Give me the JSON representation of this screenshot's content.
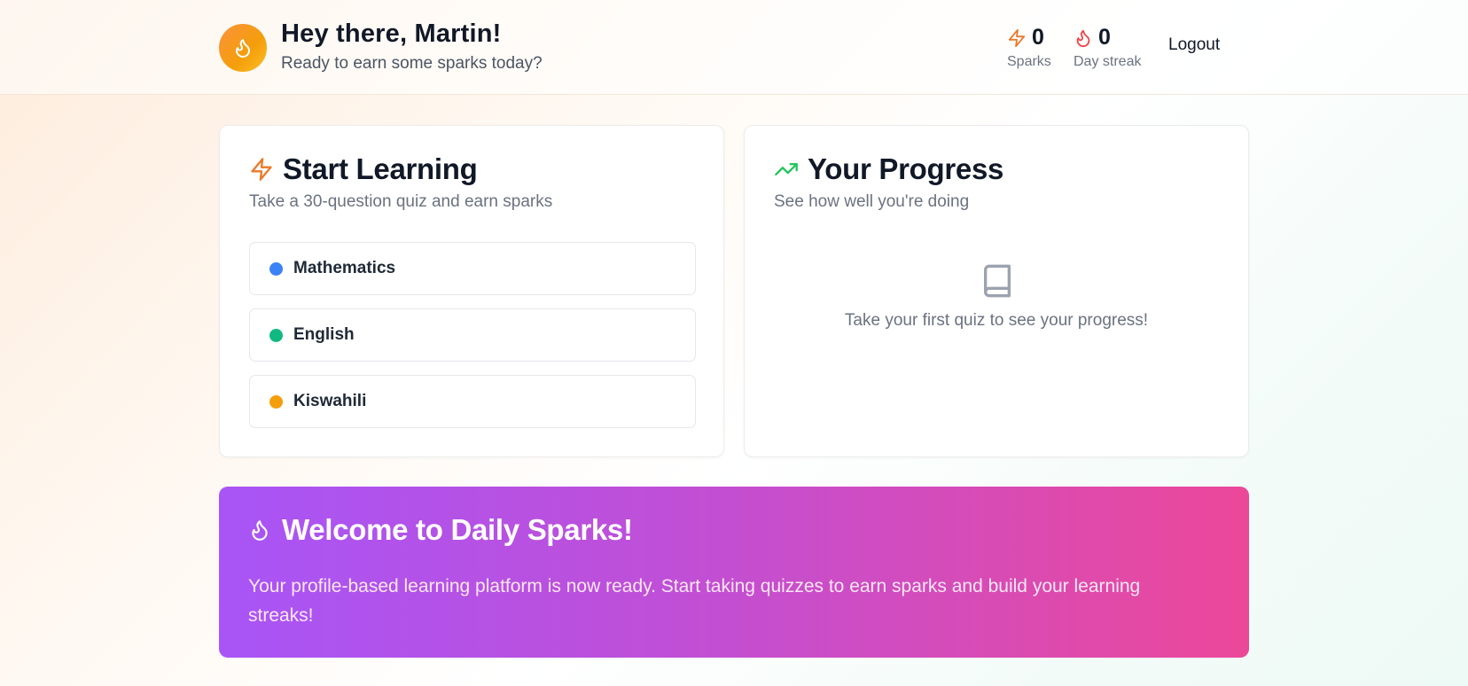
{
  "header": {
    "greeting": "Hey there, Martin!",
    "subtitle": "Ready to earn some sparks today?",
    "avatar_icon": "flame-icon",
    "stats": {
      "sparks": {
        "value": "0",
        "label": "Sparks",
        "icon": "bolt-icon",
        "color": "#ea7a2a"
      },
      "streak": {
        "value": "0",
        "label": "Day streak",
        "icon": "flame-icon",
        "color": "#ef4444"
      }
    },
    "logout_label": "Logout"
  },
  "learning": {
    "title": "Start Learning",
    "subtitle": "Take a 30-question quiz and earn sparks",
    "icon": "bolt-icon",
    "subjects": [
      {
        "name": "Mathematics",
        "color": "#3b82f6"
      },
      {
        "name": "English",
        "color": "#10b981"
      },
      {
        "name": "Kiswahili",
        "color": "#f59e0b"
      }
    ]
  },
  "progress": {
    "title": "Your Progress",
    "subtitle": "See how well you're doing",
    "icon": "trending-up-icon",
    "empty_icon": "book-icon",
    "empty_text": "Take your first quiz to see your progress!"
  },
  "banner": {
    "title": "Welcome to Daily Sparks!",
    "icon": "flame-icon",
    "text": "Your profile-based learning platform is now ready. Start taking quizzes to earn sparks and build your learning streaks!"
  },
  "colors": {
    "accent_orange": "#f59e0b",
    "accent_green": "#22c55e",
    "banner_start": "#a855f7",
    "banner_end": "#ec4899"
  }
}
